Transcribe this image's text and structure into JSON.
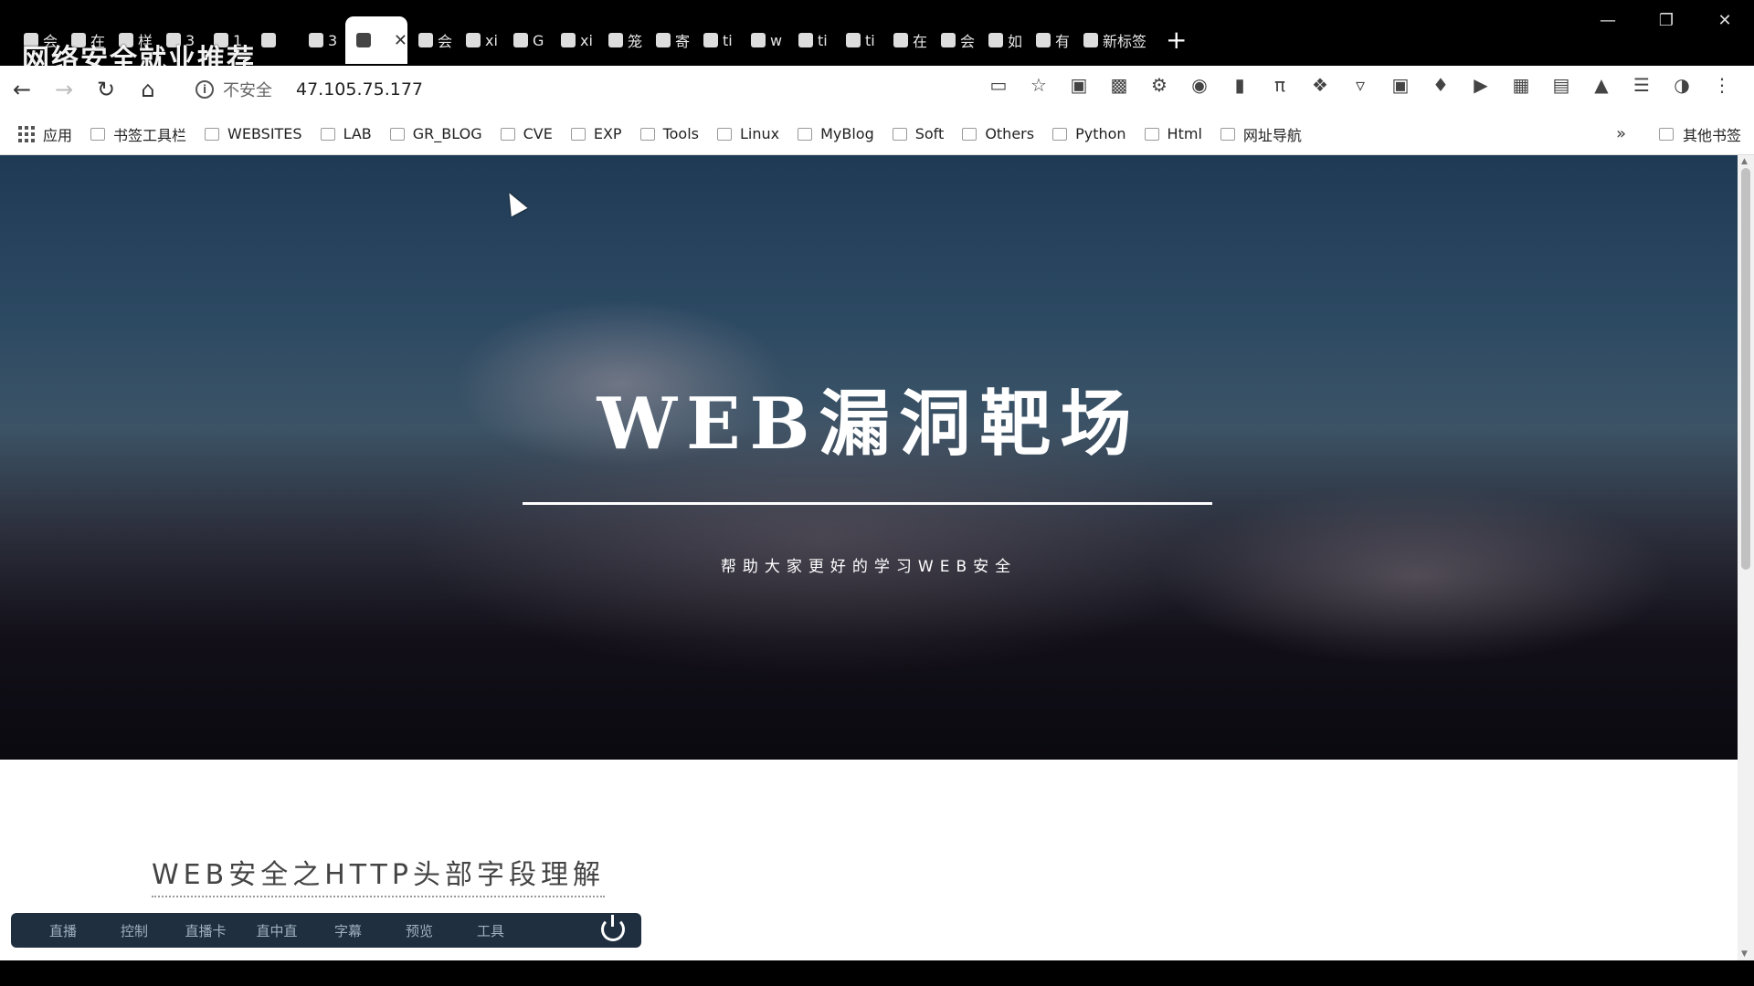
{
  "overlay_title": "网络安全就业推荐",
  "tabs": [
    {
      "label": "会",
      "active": false
    },
    {
      "label": "在",
      "active": false
    },
    {
      "label": "样",
      "active": false
    },
    {
      "label": "3",
      "active": false
    },
    {
      "label": "1",
      "active": false
    },
    {
      "label": "",
      "active": false
    },
    {
      "label": "3",
      "active": false
    },
    {
      "label": "",
      "active": true
    },
    {
      "label": "会",
      "active": false
    },
    {
      "label": "xi",
      "active": false
    },
    {
      "label": "G",
      "active": false
    },
    {
      "label": "xi",
      "active": false
    },
    {
      "label": "笼",
      "active": false
    },
    {
      "label": "寄",
      "active": false
    },
    {
      "label": "ti",
      "active": false
    },
    {
      "label": "w",
      "active": false
    },
    {
      "label": "ti",
      "active": false
    },
    {
      "label": "ti",
      "active": false
    },
    {
      "label": "在",
      "active": false
    },
    {
      "label": "会",
      "active": false
    },
    {
      "label": "如",
      "active": false
    },
    {
      "label": "有",
      "active": false
    },
    {
      "label": "新标签",
      "active": false
    }
  ],
  "toolbar": {
    "security_label": "不安全",
    "url": "47.105.75.177"
  },
  "bookmarks": {
    "apps_label": "应用",
    "items": [
      "书签工具栏",
      "WEBSITES",
      "LAB",
      "GR_BLOG",
      "CVE",
      "EXP",
      "Tools",
      "Linux",
      "MyBlog",
      "Soft",
      "Others",
      "Python",
      "Html",
      "网址导航"
    ],
    "overflow": "»",
    "other_label": "其他书签"
  },
  "hero": {
    "title": "WEB漏洞靶场",
    "subtitle": "帮助大家更好的学习WEB安全"
  },
  "article": {
    "title": "WEB安全之HTTP头部字段理解"
  },
  "float_bar": {
    "items": [
      "直播",
      "控制",
      "直播卡",
      "直中直",
      "字幕",
      "预览",
      "工具"
    ]
  }
}
